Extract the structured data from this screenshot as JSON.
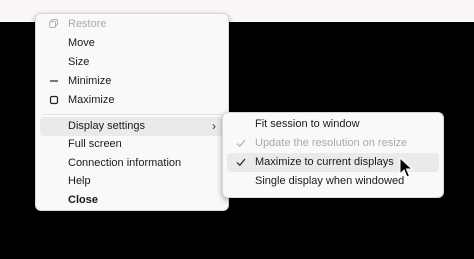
{
  "window_menu": {
    "items": [
      {
        "label": "Restore",
        "icon": "restore-icon",
        "disabled": true
      },
      {
        "label": "Move"
      },
      {
        "label": "Size"
      },
      {
        "label": "Minimize",
        "icon": "minimize-icon"
      },
      {
        "label": "Maximize",
        "icon": "maximize-icon"
      },
      {
        "label": "Display settings",
        "submenu": true,
        "highlighted": true
      },
      {
        "label": "Full screen"
      },
      {
        "label": "Connection information"
      },
      {
        "label": "Help"
      },
      {
        "label": "Close",
        "bold": true
      }
    ]
  },
  "display_submenu": {
    "items": [
      {
        "label": "Fit session to window",
        "checked": false
      },
      {
        "label": "Update the resolution on resize",
        "checked": true,
        "disabled": true
      },
      {
        "label": "Maximize to current displays",
        "checked": true,
        "highlighted": true
      },
      {
        "label": "Single display when windowed",
        "checked": false
      }
    ]
  },
  "colors": {
    "menu_background": "#f9f9f9",
    "highlight": "#eaeaea",
    "disabled_text": "#a9a9a9",
    "page_background": "#000000"
  }
}
